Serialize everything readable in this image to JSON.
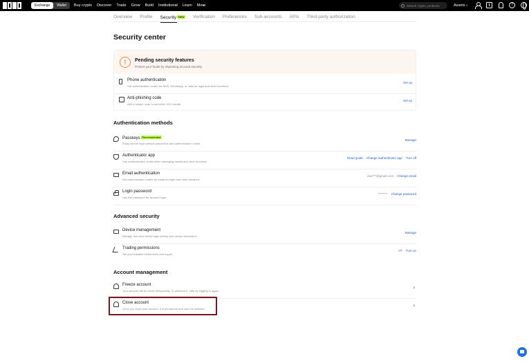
{
  "topbar": {
    "mode_tabs": [
      "Exchange",
      "Wallet"
    ],
    "nav": [
      "Buy crypto",
      "Discover",
      "Trade",
      "Grow",
      "Build",
      "Institutional",
      "Learn",
      "More"
    ],
    "search_placeholder": "Search crypto, products",
    "assets": "Assets"
  },
  "subtabs": [
    "Overview",
    "Profile",
    "Security",
    "Verification",
    "Preferences",
    "Sub-accounts",
    "APIs",
    "Third-party authorization"
  ],
  "new_badge": "New",
  "page_title": "Security center",
  "pending": {
    "title": "Pending security features",
    "subtitle": "Protect your funds by improving account security",
    "items": [
      {
        "label": "Phone authentication",
        "desc": "Get authentication codes via SMS, WhatsApp, or calls for login and other functions",
        "action": "Set up",
        "icon": "phone-icon"
      },
      {
        "label": "Anti-phishing code",
        "desc": "Add a unique code to authentic OKX emails",
        "action": "Set up",
        "icon": "anti-phishing-icon"
      }
    ]
  },
  "auth_methods": {
    "title": "Authentication methods",
    "passkeys": {
      "label": "Passkeys",
      "badge": "Recommended",
      "desc": "Enjoy secure login without passwords and authentication codes",
      "action": "Manage"
    },
    "authenticator": {
      "label": "Authenticator app",
      "desc": "Use authentication codes when managing assets and other functions",
      "actions": [
        "Read guide",
        "Change authenticator app",
        "Turn off"
      ]
    },
    "email": {
      "label": "Email authentication",
      "desc": "Get authentication codes via email for login and other functions",
      "value": "zwo***@gmail.com",
      "action": "Change email"
    },
    "password": {
      "label": "Login password",
      "desc": "Use this password for account login",
      "value": "********",
      "action": "Change password"
    }
  },
  "advanced": {
    "title": "Advanced security",
    "device": {
      "label": "Device management",
      "desc": "Manage and view recent login activity and device information",
      "action": "Manage"
    },
    "trading": {
      "label": "Trading permissions",
      "desc": "Set your tradable instruments and crypto",
      "status": "Off",
      "action": "Turn on"
    }
  },
  "account_mgmt": {
    "title": "Account management",
    "freeze": {
      "label": "Freeze account",
      "desc": "Your account will be frozen temporarily. To unfreeze it, start by logging in again"
    },
    "close": {
      "label": "Close account",
      "desc": "Once you close your account, it is permanent and can't be restored"
    }
  },
  "colors": {
    "accent_link": "#1f5fd6",
    "badge": "#b6ff3b",
    "warning": "#f08a3c",
    "highlight": "#7a1520"
  }
}
